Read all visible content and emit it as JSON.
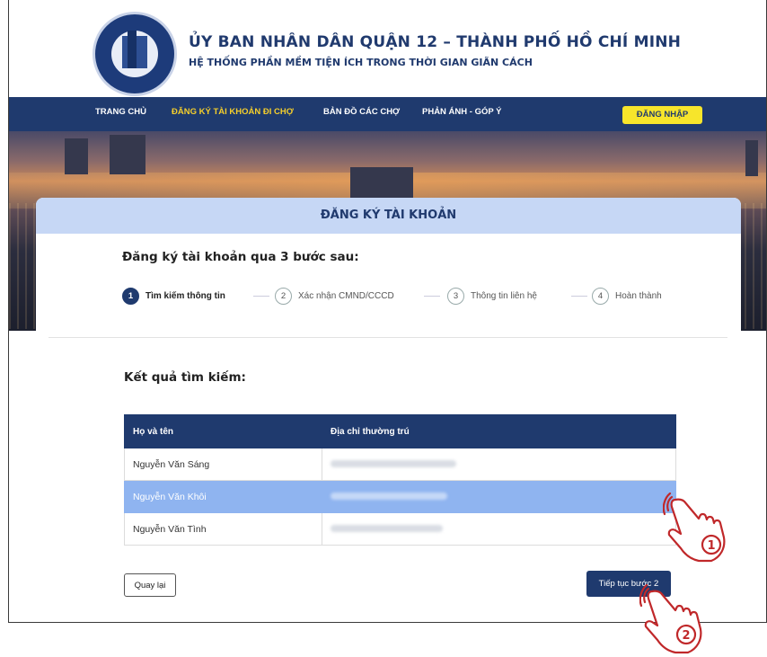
{
  "header": {
    "title": "ỦY BAN NHÂN DÂN QUẬN 12 – THÀNH PHỐ HỒ CHÍ MINH",
    "subtitle": "HỆ THỐNG PHẦN MỀM TIỆN ÍCH TRONG THỜI GIAN GIÃN CÁCH"
  },
  "nav": {
    "items": [
      "TRANG CHỦ",
      "ĐĂNG KÝ TÀI KHOẢN ĐI CHỢ",
      "BẢN ĐỒ CÁC CHỢ",
      "PHẢN ÁNH - GÓP Ý"
    ],
    "active_index": 1,
    "login_label": "ĐĂNG NHẬP"
  },
  "card": {
    "heading": "ĐĂNG KÝ TÀI KHOẢN",
    "steps_title": "Đăng ký tài khoản qua 3 bước sau:",
    "steps": [
      {
        "num": "1",
        "label": "Tìm kiếm thông tin"
      },
      {
        "num": "2",
        "label": "Xác nhận CMND/CCCD"
      },
      {
        "num": "3",
        "label": "Thông tin liên hệ"
      },
      {
        "num": "4",
        "label": "Hoàn thành"
      }
    ],
    "active_step": 1,
    "result_title": "Kết quả tìm kiếm:",
    "table": {
      "columns": [
        "Họ và tên",
        "Địa chỉ thường trú"
      ],
      "rows": [
        {
          "name": "Nguyễn Văn Sáng",
          "address_redacted": true
        },
        {
          "name": "Nguyễn Văn Khôi",
          "address_redacted": true,
          "selected": true
        },
        {
          "name": "Nguyễn Văn Tình",
          "address_redacted": true
        }
      ]
    },
    "back_label": "Quay lại",
    "next_label": "Tiếp tục bước 2"
  },
  "annotations": {
    "hand1_label": "1",
    "hand2_label": "2"
  },
  "colors": {
    "navy": "#1f3a6e",
    "accent_yellow": "#f7e52b",
    "selected_row": "#8fb4f0",
    "card_header": "#c6d7f5",
    "annotation_red": "#c0282a"
  }
}
